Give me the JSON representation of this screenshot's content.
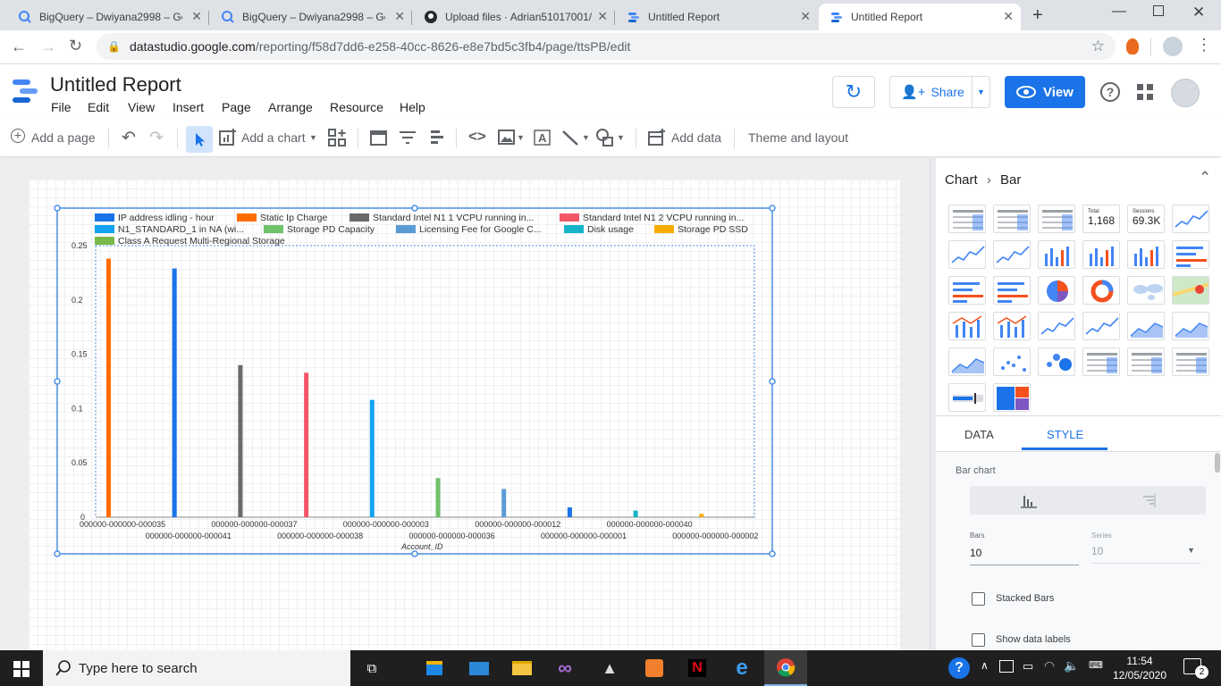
{
  "browser": {
    "tabs": [
      {
        "title": "BigQuery – Dwiyana2998 – Go",
        "icon": "bigquery-icon"
      },
      {
        "title": "BigQuery – Dwiyana2998 – Go",
        "icon": "bigquery-icon"
      },
      {
        "title": "Upload files · Adrian51017001/",
        "icon": "github-icon"
      },
      {
        "title": "Untitled Report",
        "icon": "datastudio-icon"
      },
      {
        "title": "Untitled Report",
        "icon": "datastudio-icon"
      }
    ],
    "url_host": "datastudio.google.com",
    "url_path": "/reporting/f58d7dd6-e258-40cc-8626-e8e7bd5c3fb4/page/ttsPB/edit"
  },
  "app": {
    "title": "Untitled Report",
    "menu": [
      "File",
      "Edit",
      "View",
      "Insert",
      "Page",
      "Arrange",
      "Resource",
      "Help"
    ],
    "share_label": "Share",
    "view_label": "View"
  },
  "toolbar": {
    "add_page": "Add a page",
    "add_chart": "Add a chart",
    "add_data": "Add data",
    "theme_layout": "Theme and layout"
  },
  "chart_data": {
    "type": "bar",
    "xlabel": "Account_ID",
    "ylim": [
      0,
      0.25
    ],
    "yticks": [
      "0.25",
      "0.2",
      "0.15",
      "0.1",
      "0.05",
      "0"
    ],
    "x_labels_row1": [
      "000000-000000-000035",
      "000000-000000-000037",
      "000000-000000-000003",
      "000000-000000-000012",
      "000000-000000-000040"
    ],
    "x_labels_row2": [
      "000000-000000-000041",
      "000000-000000-000038",
      "000000-000000-000036",
      "000000-000000-000001",
      "000000-000000-000002"
    ],
    "legend": [
      {
        "name": "IP address idling - hour",
        "color": "#1a73e8"
      },
      {
        "name": "Static Ip Charge",
        "color": "#ff6d00"
      },
      {
        "name": "Standard Intel N1 1 VCPU running in...",
        "color": "#6a6a6a"
      },
      {
        "name": "Standard Intel N1 2 VCPU running in...",
        "color": "#f25767"
      },
      {
        "name": "N1_STANDARD_1 in NA (wi...",
        "color": "#12a4f0"
      },
      {
        "name": "Storage PD Capacity",
        "color": "#6fc16b"
      },
      {
        "name": "Licensing Fee for Google C...",
        "color": "#5b9bd5"
      },
      {
        "name": "Disk usage",
        "color": "#16b4c8"
      },
      {
        "name": "Storage PD SSD",
        "color": "#f9ab00"
      },
      {
        "name": "Class A Request Multi-Regional Storage",
        "color": "#79b94a"
      }
    ],
    "bars": [
      {
        "slot": 0,
        "value": 0.238,
        "color": "#ff6d00"
      },
      {
        "slot": 1,
        "value": 0.229,
        "color": "#1a73e8"
      },
      {
        "slot": 2,
        "value": 0.14,
        "color": "#6a6a6a"
      },
      {
        "slot": 3,
        "value": 0.133,
        "color": "#f25767"
      },
      {
        "slot": 4,
        "value": 0.108,
        "color": "#12a4f0"
      },
      {
        "slot": 5,
        "value": 0.036,
        "color": "#6fc16b"
      },
      {
        "slot": 6,
        "value": 0.026,
        "color": "#5b9bd5"
      },
      {
        "slot": 7,
        "value": 0.009,
        "color": "#1a73e8"
      },
      {
        "slot": 8,
        "value": 0.006,
        "color": "#16b4c8"
      },
      {
        "slot": 9,
        "value": 0.003,
        "color": "#f9ab00"
      }
    ]
  },
  "panel": {
    "breadcrumb_1": "Chart",
    "breadcrumb_2": "Bar",
    "scorecard_total_label": "Total",
    "scorecard_total_value": "1,168",
    "scorecard_sessions_label": "Sessions",
    "scorecard_sessions_value": "69.3K",
    "tab_data": "DATA",
    "tab_style": "STYLE",
    "section_title": "Bar chart",
    "bars_label": "Bars",
    "bars_value": "10",
    "series_label": "Series",
    "series_value": "10",
    "stacked_bars": "Stacked Bars",
    "show_data_labels": "Show data labels"
  },
  "taskbar": {
    "search_placeholder": "Type here to search",
    "time": "11:54",
    "date": "12/05/2020",
    "notifications": "2"
  }
}
